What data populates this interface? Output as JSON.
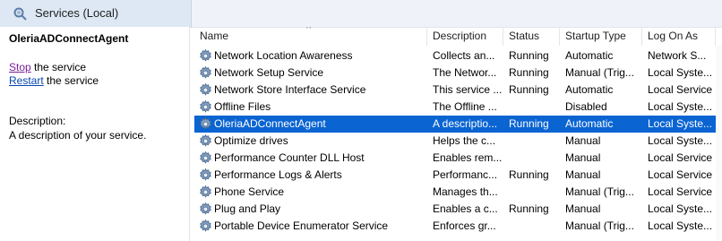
{
  "window": {
    "title": "Services (Local)"
  },
  "left_pane": {
    "service_name": "OleriaADConnectAgent",
    "stop_link": "Stop",
    "stop_suffix": " the service",
    "restart_link": "Restart",
    "restart_suffix": " the service",
    "description_label": "Description:",
    "description_text": "A description of your service."
  },
  "table": {
    "columns": [
      "Name",
      "Description",
      "Status",
      "Startup Type",
      "Log On As"
    ],
    "sort_indicator": "^",
    "rows": [
      {
        "name": "Network Location Awareness",
        "description": "Collects an...",
        "status": "Running",
        "startup": "Automatic",
        "logon": "Network S..."
      },
      {
        "name": "Network Setup Service",
        "description": "The Networ...",
        "status": "Running",
        "startup": "Manual (Trig...",
        "logon": "Local Syste..."
      },
      {
        "name": "Network Store Interface Service",
        "description": "This service ...",
        "status": "Running",
        "startup": "Automatic",
        "logon": "Local Service"
      },
      {
        "name": "Offline Files",
        "description": "The Offline ...",
        "status": "",
        "startup": "Disabled",
        "logon": "Local Syste..."
      },
      {
        "name": "OleriaADConnectAgent",
        "description": "A descriptio...",
        "status": "Running",
        "startup": "Automatic",
        "logon": "Local Syste...",
        "selected": true
      },
      {
        "name": "Optimize drives",
        "description": "Helps the c...",
        "status": "",
        "startup": "Manual",
        "logon": "Local Syste..."
      },
      {
        "name": "Performance Counter DLL Host",
        "description": "Enables rem...",
        "status": "",
        "startup": "Manual",
        "logon": "Local Service"
      },
      {
        "name": "Performance Logs & Alerts",
        "description": "Performanc...",
        "status": "Running",
        "startup": "Manual",
        "logon": "Local Service"
      },
      {
        "name": "Phone Service",
        "description": "Manages th...",
        "status": "",
        "startup": "Manual (Trig...",
        "logon": "Local Service"
      },
      {
        "name": "Plug and Play",
        "description": "Enables a c...",
        "status": "Running",
        "startup": "Manual",
        "logon": "Local Syste..."
      },
      {
        "name": "Portable Device Enumerator Service",
        "description": "Enforces gr...",
        "status": "",
        "startup": "Manual (Trig...",
        "logon": "Local Syste..."
      }
    ]
  },
  "colors": {
    "selection": "#0a64d2",
    "title_tab": "#dde8f4",
    "link": "#0645ad",
    "visited_link": "#7a1f9a"
  },
  "icons": {
    "title": "gear-magnifier-icon",
    "service": "gear-icon"
  }
}
